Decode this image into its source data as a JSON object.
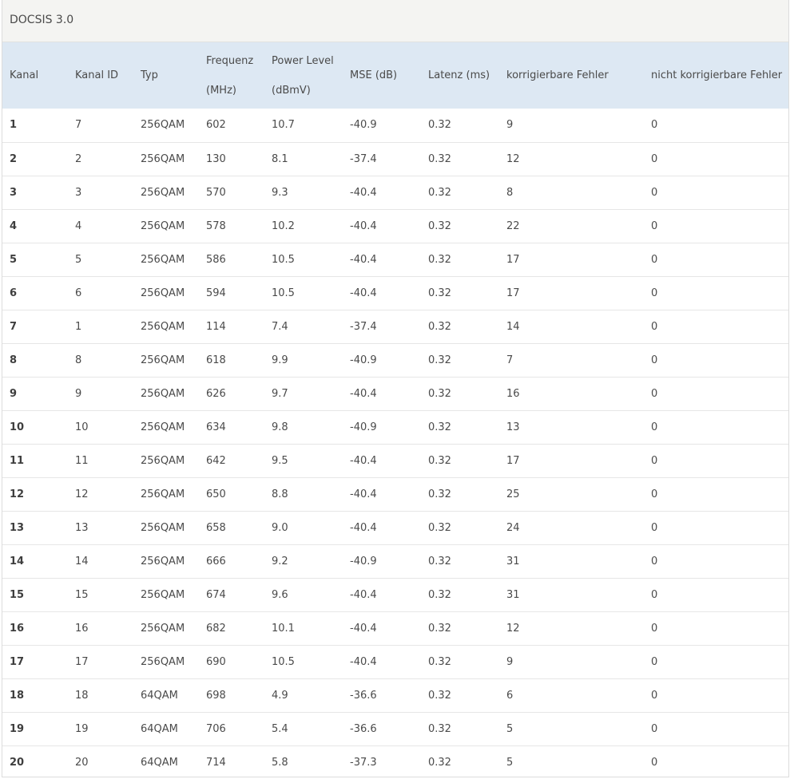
{
  "panel": {
    "title": "DOCSIS 3.0"
  },
  "columns": [
    {
      "label": "Kanal",
      "line1": "Kanal",
      "line2": ""
    },
    {
      "label": "Kanal ID",
      "line1": "Kanal ID",
      "line2": ""
    },
    {
      "label": "Typ",
      "line1": "Typ",
      "line2": ""
    },
    {
      "label": "Frequenz (MHz)",
      "line1": "Frequenz",
      "line2": "(MHz)"
    },
    {
      "label": "Power Level (dBmV)",
      "line1": "Power Level",
      "line2": "(dBmV)"
    },
    {
      "label": "MSE (dB)",
      "line1": "MSE (dB)",
      "line2": ""
    },
    {
      "label": "Latenz (ms)",
      "line1": "Latenz (ms)",
      "line2": ""
    },
    {
      "label": "korrigierbare Fehler",
      "line1": "korrigierbare Fehler",
      "line2": ""
    },
    {
      "label": "nicht korrigierbare Fehler",
      "line1": "nicht korrigierbare Fehler",
      "line2": ""
    }
  ],
  "rows": [
    [
      "1",
      "7",
      "256QAM",
      "602",
      "10.7",
      "-40.9",
      "0.32",
      "9",
      "0"
    ],
    [
      "2",
      "2",
      "256QAM",
      "130",
      "8.1",
      "-37.4",
      "0.32",
      "12",
      "0"
    ],
    [
      "3",
      "3",
      "256QAM",
      "570",
      "9.3",
      "-40.4",
      "0.32",
      "8",
      "0"
    ],
    [
      "4",
      "4",
      "256QAM",
      "578",
      "10.2",
      "-40.4",
      "0.32",
      "22",
      "0"
    ],
    [
      "5",
      "5",
      "256QAM",
      "586",
      "10.5",
      "-40.4",
      "0.32",
      "17",
      "0"
    ],
    [
      "6",
      "6",
      "256QAM",
      "594",
      "10.5",
      "-40.4",
      "0.32",
      "17",
      "0"
    ],
    [
      "7",
      "1",
      "256QAM",
      "114",
      "7.4",
      "-37.4",
      "0.32",
      "14",
      "0"
    ],
    [
      "8",
      "8",
      "256QAM",
      "618",
      "9.9",
      "-40.9",
      "0.32",
      "7",
      "0"
    ],
    [
      "9",
      "9",
      "256QAM",
      "626",
      "9.7",
      "-40.4",
      "0.32",
      "16",
      "0"
    ],
    [
      "10",
      "10",
      "256QAM",
      "634",
      "9.8",
      "-40.9",
      "0.32",
      "13",
      "0"
    ],
    [
      "11",
      "11",
      "256QAM",
      "642",
      "9.5",
      "-40.4",
      "0.32",
      "17",
      "0"
    ],
    [
      "12",
      "12",
      "256QAM",
      "650",
      "8.8",
      "-40.4",
      "0.32",
      "25",
      "0"
    ],
    [
      "13",
      "13",
      "256QAM",
      "658",
      "9.0",
      "-40.4",
      "0.32",
      "24",
      "0"
    ],
    [
      "14",
      "14",
      "256QAM",
      "666",
      "9.2",
      "-40.9",
      "0.32",
      "31",
      "0"
    ],
    [
      "15",
      "15",
      "256QAM",
      "674",
      "9.6",
      "-40.4",
      "0.32",
      "31",
      "0"
    ],
    [
      "16",
      "16",
      "256QAM",
      "682",
      "10.1",
      "-40.4",
      "0.32",
      "12",
      "0"
    ],
    [
      "17",
      "17",
      "256QAM",
      "690",
      "10.5",
      "-40.4",
      "0.32",
      "9",
      "0"
    ],
    [
      "18",
      "18",
      "64QAM",
      "698",
      "4.9",
      "-36.6",
      "0.32",
      "6",
      "0"
    ],
    [
      "19",
      "19",
      "64QAM",
      "706",
      "5.4",
      "-36.6",
      "0.32",
      "5",
      "0"
    ],
    [
      "20",
      "20",
      "64QAM",
      "714",
      "5.8",
      "-37.3",
      "0.32",
      "5",
      "0"
    ]
  ],
  "colors": {
    "header_bg": "#dde8f3",
    "title_bg": "#f4f4f2",
    "text": "#4a4a4a",
    "row_border": "#e6e6e6"
  }
}
